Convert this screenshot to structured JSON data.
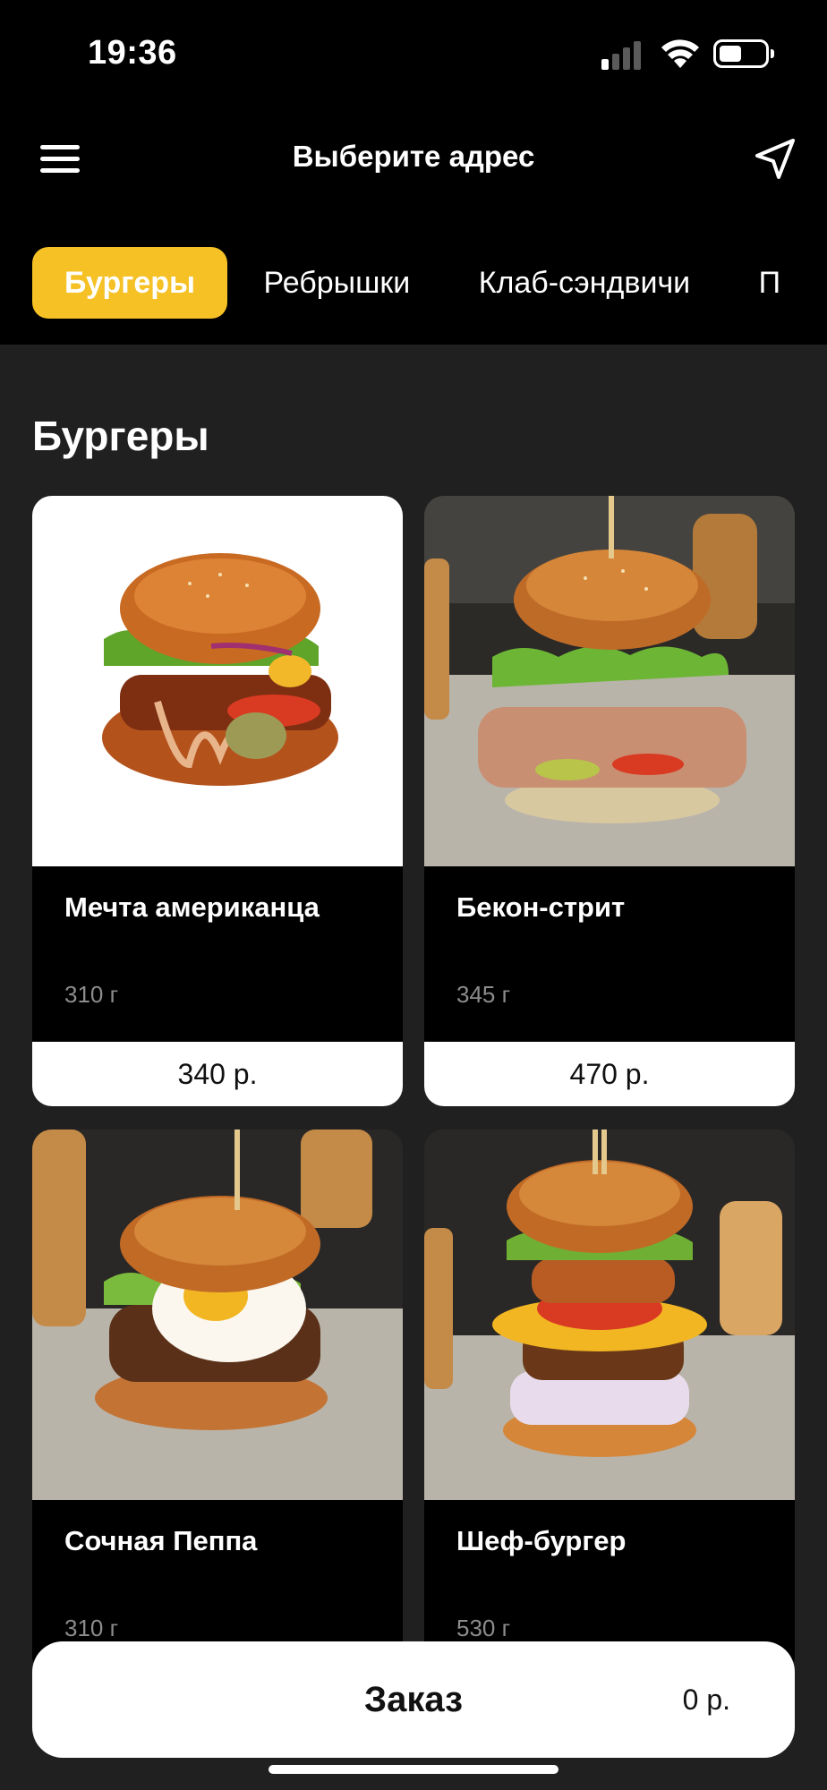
{
  "status": {
    "time": "19:36"
  },
  "header": {
    "title": "Выберите адрес",
    "menu_icon": "hamburger-menu-icon",
    "nav_icon": "location-arrow-icon"
  },
  "tabs": [
    {
      "label": "Бургеры",
      "active": true
    },
    {
      "label": "Ребрышки",
      "active": false
    },
    {
      "label": "Клаб-сэндвичи",
      "active": false
    },
    {
      "label": "П",
      "active": false
    }
  ],
  "section": {
    "title": "Бургеры"
  },
  "products": [
    {
      "name": "Мечта американца",
      "weight": "310 г",
      "price": "340 р."
    },
    {
      "name": "Бекон-стрит",
      "weight": "345 г",
      "price": "470 р."
    },
    {
      "name": "Сочная Пеппа",
      "weight": "310 г"
    },
    {
      "name": "Шеф-бургер",
      "weight": "530 г"
    }
  ],
  "order": {
    "label": "Заказ",
    "sum": "0 р."
  },
  "colors": {
    "accent": "#f5c125",
    "background": "#202020",
    "header": "#000000"
  }
}
